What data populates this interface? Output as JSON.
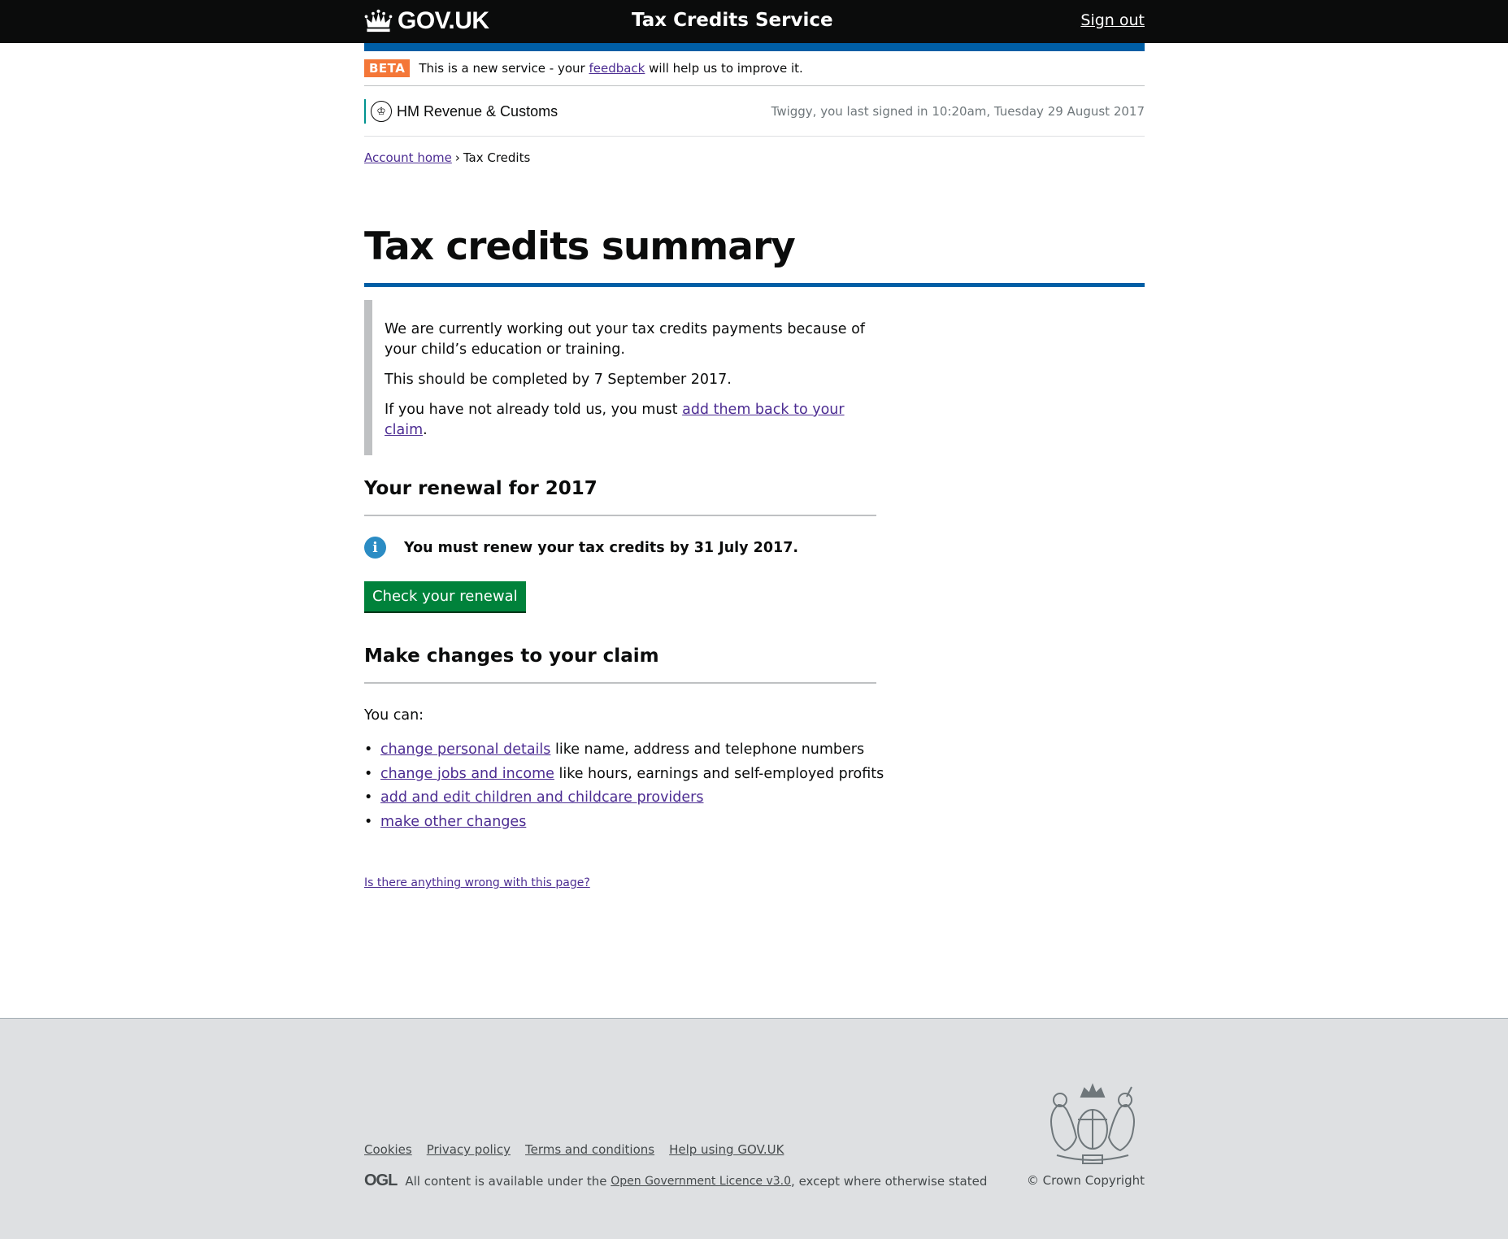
{
  "header": {
    "logo_text": "GOV.UK",
    "service_name": "Tax Credits Service",
    "sign_out": "Sign out"
  },
  "beta": {
    "tag": "BETA",
    "text_before": "This is a new service - your",
    "feedback_link": "feedback",
    "text_after": "will help us to improve it."
  },
  "hmrc": {
    "name": "HM Revenue & Customs",
    "last_signed_in": "Twiggy, you last signed in 10:20am, Tuesday 29 August 2017"
  },
  "breadcrumbs": {
    "home": "Account home",
    "separator": "›",
    "current": "Tax Credits"
  },
  "page_title": "Tax credits summary",
  "inset": {
    "p1": "We are currently working out your tax credits payments because of your child’s education or training.",
    "p2": "This should be completed by 7 September 2017.",
    "p3_before": "If you have not already told us, you must",
    "p3_link": "add them back to your claim",
    "p3_after": "."
  },
  "renewal": {
    "heading": "Your renewal for 2017",
    "notice": "You must renew your tax credits by 31 July 2017.",
    "button": "Check your renewal"
  },
  "changes": {
    "heading": "Make changes to your claim",
    "intro": "You can:",
    "items": [
      {
        "link": "change personal details",
        "text": "like name, address and telephone numbers"
      },
      {
        "link": "change jobs and income",
        "text": "like hours, earnings and self-employed profits"
      },
      {
        "link": "add and edit children and childcare providers",
        "text": ""
      },
      {
        "link": "make other changes",
        "text": ""
      }
    ]
  },
  "report_link": "Is there anything wrong with this page?",
  "footer": {
    "links": [
      "Cookies",
      "Privacy policy",
      "Terms and conditions",
      "Help using GOV.UK"
    ],
    "ogl": "OGL",
    "licence_before": "All content is available under the",
    "licence_link": "Open Government Licence v3.0",
    "licence_after": ", except where otherwise stated",
    "crown_copyright": "© Crown Copyright"
  },
  "colors": {
    "header_bg": "#0b0c0c",
    "brand_blue": "#005ea5",
    "beta_orange": "#f47738",
    "button_green": "#00823b",
    "info_blue": "#2b8cc4",
    "link_purple": "#4c2c92",
    "footer_bg": "#dee0e2"
  },
  "icons": {
    "logo": "crown-icon",
    "hmrc": "hmrc-crest-icon",
    "info": "info-icon",
    "footer_crest": "royal-coat-of-arms"
  }
}
